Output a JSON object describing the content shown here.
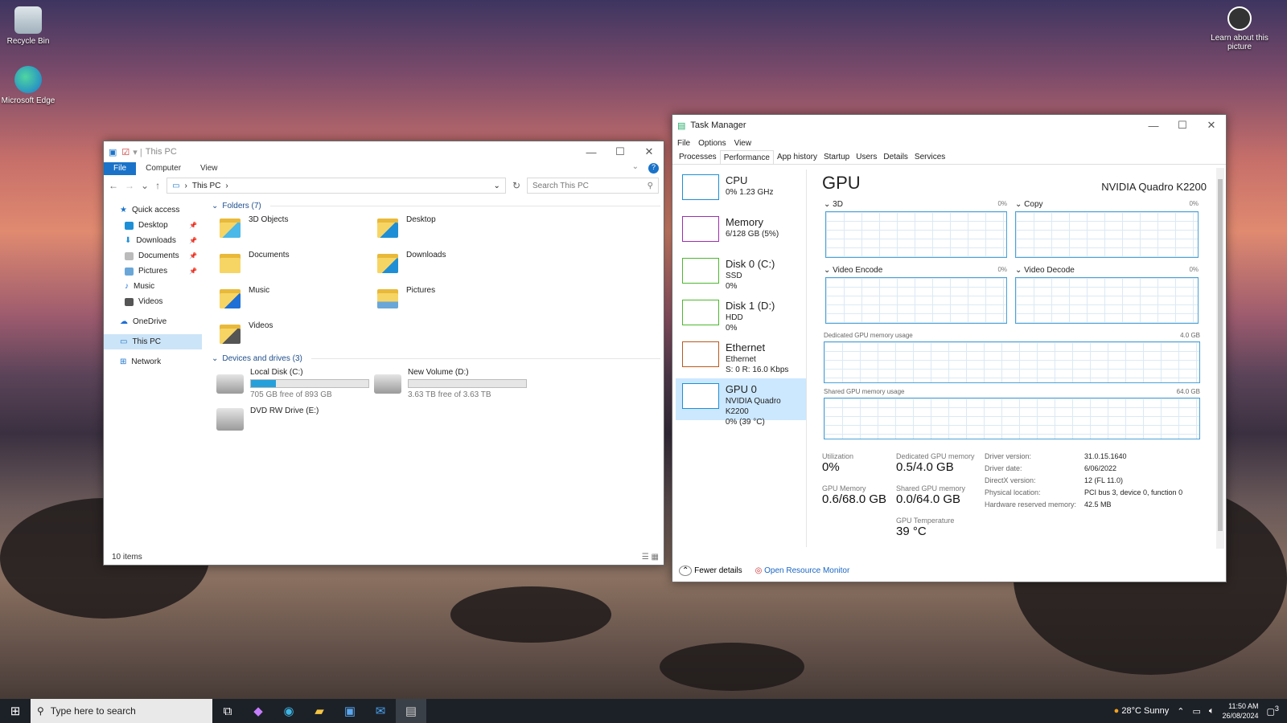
{
  "desktop": {
    "icons": [
      {
        "label": "Recycle Bin"
      },
      {
        "label": "Microsoft Edge"
      }
    ],
    "learn": "Learn about this picture"
  },
  "explorer": {
    "title": "This PC",
    "ribbon": [
      "File",
      "Computer",
      "View"
    ],
    "address": "This PC",
    "search_placeholder": "Search This PC",
    "nav": {
      "quick": "Quick access",
      "items": [
        "Desktop",
        "Downloads",
        "Documents",
        "Pictures",
        "Music",
        "Videos"
      ],
      "onedrive": "OneDrive",
      "thispc": "This PC",
      "network": "Network"
    },
    "folders_header": "Folders (7)",
    "folders": [
      "3D Objects",
      "Desktop",
      "Documents",
      "Downloads",
      "Music",
      "Pictures",
      "Videos"
    ],
    "drives_header": "Devices and drives (3)",
    "drives": [
      {
        "name": "Local Disk (C:)",
        "free": "705 GB free of 893 GB",
        "used_fraction": 0.21
      },
      {
        "name": "New Volume (D:)",
        "free": "3.63 TB free of 3.63 TB",
        "used_fraction": 0.0
      },
      {
        "name": "DVD RW Drive (E:)"
      }
    ],
    "status": "10 items"
  },
  "taskmgr": {
    "title": "Task Manager",
    "menu": [
      "File",
      "Options",
      "View"
    ],
    "tabs": [
      "Processes",
      "Performance",
      "App history",
      "Startup",
      "Users",
      "Details",
      "Services"
    ],
    "side": [
      {
        "name": "CPU",
        "l1": "0% 1.23 GHz",
        "l2": "",
        "color": "#1e8fd6"
      },
      {
        "name": "Memory",
        "l1": "6/128 GB (5%)",
        "l2": "",
        "color": "#9b2fae"
      },
      {
        "name": "Disk 0 (C:)",
        "l1": "SSD",
        "l2": "0%",
        "color": "#4db82d"
      },
      {
        "name": "Disk 1 (D:)",
        "l1": "HDD",
        "l2": "0%",
        "color": "#4db82d"
      },
      {
        "name": "Ethernet",
        "l1": "Ethernet",
        "l2": "S: 0 R: 16.0 Kbps",
        "color": "#b85a1e"
      },
      {
        "name": "GPU 0",
        "l1": "NVIDIA Quadro K2200",
        "l2": "0% (39 °C)",
        "color": "#1e8fd6"
      }
    ],
    "gpu": {
      "heading": "GPU",
      "model": "NVIDIA Quadro K2200",
      "engines": [
        {
          "name": "3D",
          "pct": "0%"
        },
        {
          "name": "Copy",
          "pct": "0%"
        },
        {
          "name": "Video Encode",
          "pct": "0%"
        },
        {
          "name": "Video Decode",
          "pct": "0%"
        }
      ],
      "dedicated_label": "Dedicated GPU memory usage",
      "dedicated_max": "4.0 GB",
      "shared_label": "Shared GPU memory usage",
      "shared_max": "64.0 GB",
      "stats": {
        "util_l": "Utilization",
        "util": "0%",
        "ded_l": "Dedicated GPU memory",
        "ded": "0.5/4.0 GB",
        "gmem_l": "GPU Memory",
        "gmem": "0.6/68.0 GB",
        "sh_l": "Shared GPU memory",
        "sh": "0.0/64.0 GB",
        "temp_l": "GPU Temperature",
        "temp": "39 °C"
      },
      "details": [
        {
          "k": "Driver version:",
          "v": "31.0.15.1640"
        },
        {
          "k": "Driver date:",
          "v": "6/06/2022"
        },
        {
          "k": "DirectX version:",
          "v": "12 (FL 11.0)"
        },
        {
          "k": "Physical location:",
          "v": "PCI bus 3, device 0, function 0"
        },
        {
          "k": "Hardware reserved memory:",
          "v": "42.5 MB"
        }
      ]
    },
    "fewer": "Fewer details",
    "resmon": "Open Resource Monitor"
  },
  "taskbar": {
    "search": "Type here to search",
    "weather": "28°C  Sunny",
    "time": "11:50 AM",
    "date": "26/08/2024",
    "notif": "3"
  }
}
